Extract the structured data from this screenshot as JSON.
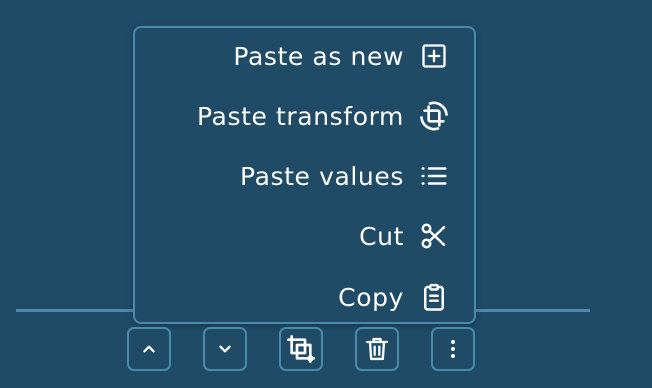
{
  "context_menu": {
    "items": [
      {
        "label": "Paste as new",
        "icon": "plus-square-icon"
      },
      {
        "label": "Paste transform",
        "icon": "crop-rotate-icon"
      },
      {
        "label": "Paste values",
        "icon": "list-icon"
      },
      {
        "label": "Cut",
        "icon": "scissors-icon"
      },
      {
        "label": "Copy",
        "icon": "clipboard-icon"
      }
    ]
  },
  "toolbar": {
    "buttons": [
      {
        "icon": "chevron-up-icon"
      },
      {
        "icon": "chevron-down-icon"
      },
      {
        "icon": "transform-icon"
      },
      {
        "icon": "trash-icon"
      },
      {
        "icon": "more-vertical-icon"
      }
    ]
  },
  "colors": {
    "background": "#1f4b67",
    "border": "#4a8aab",
    "divider": "#4f8aa8",
    "text": "#ffffff"
  }
}
